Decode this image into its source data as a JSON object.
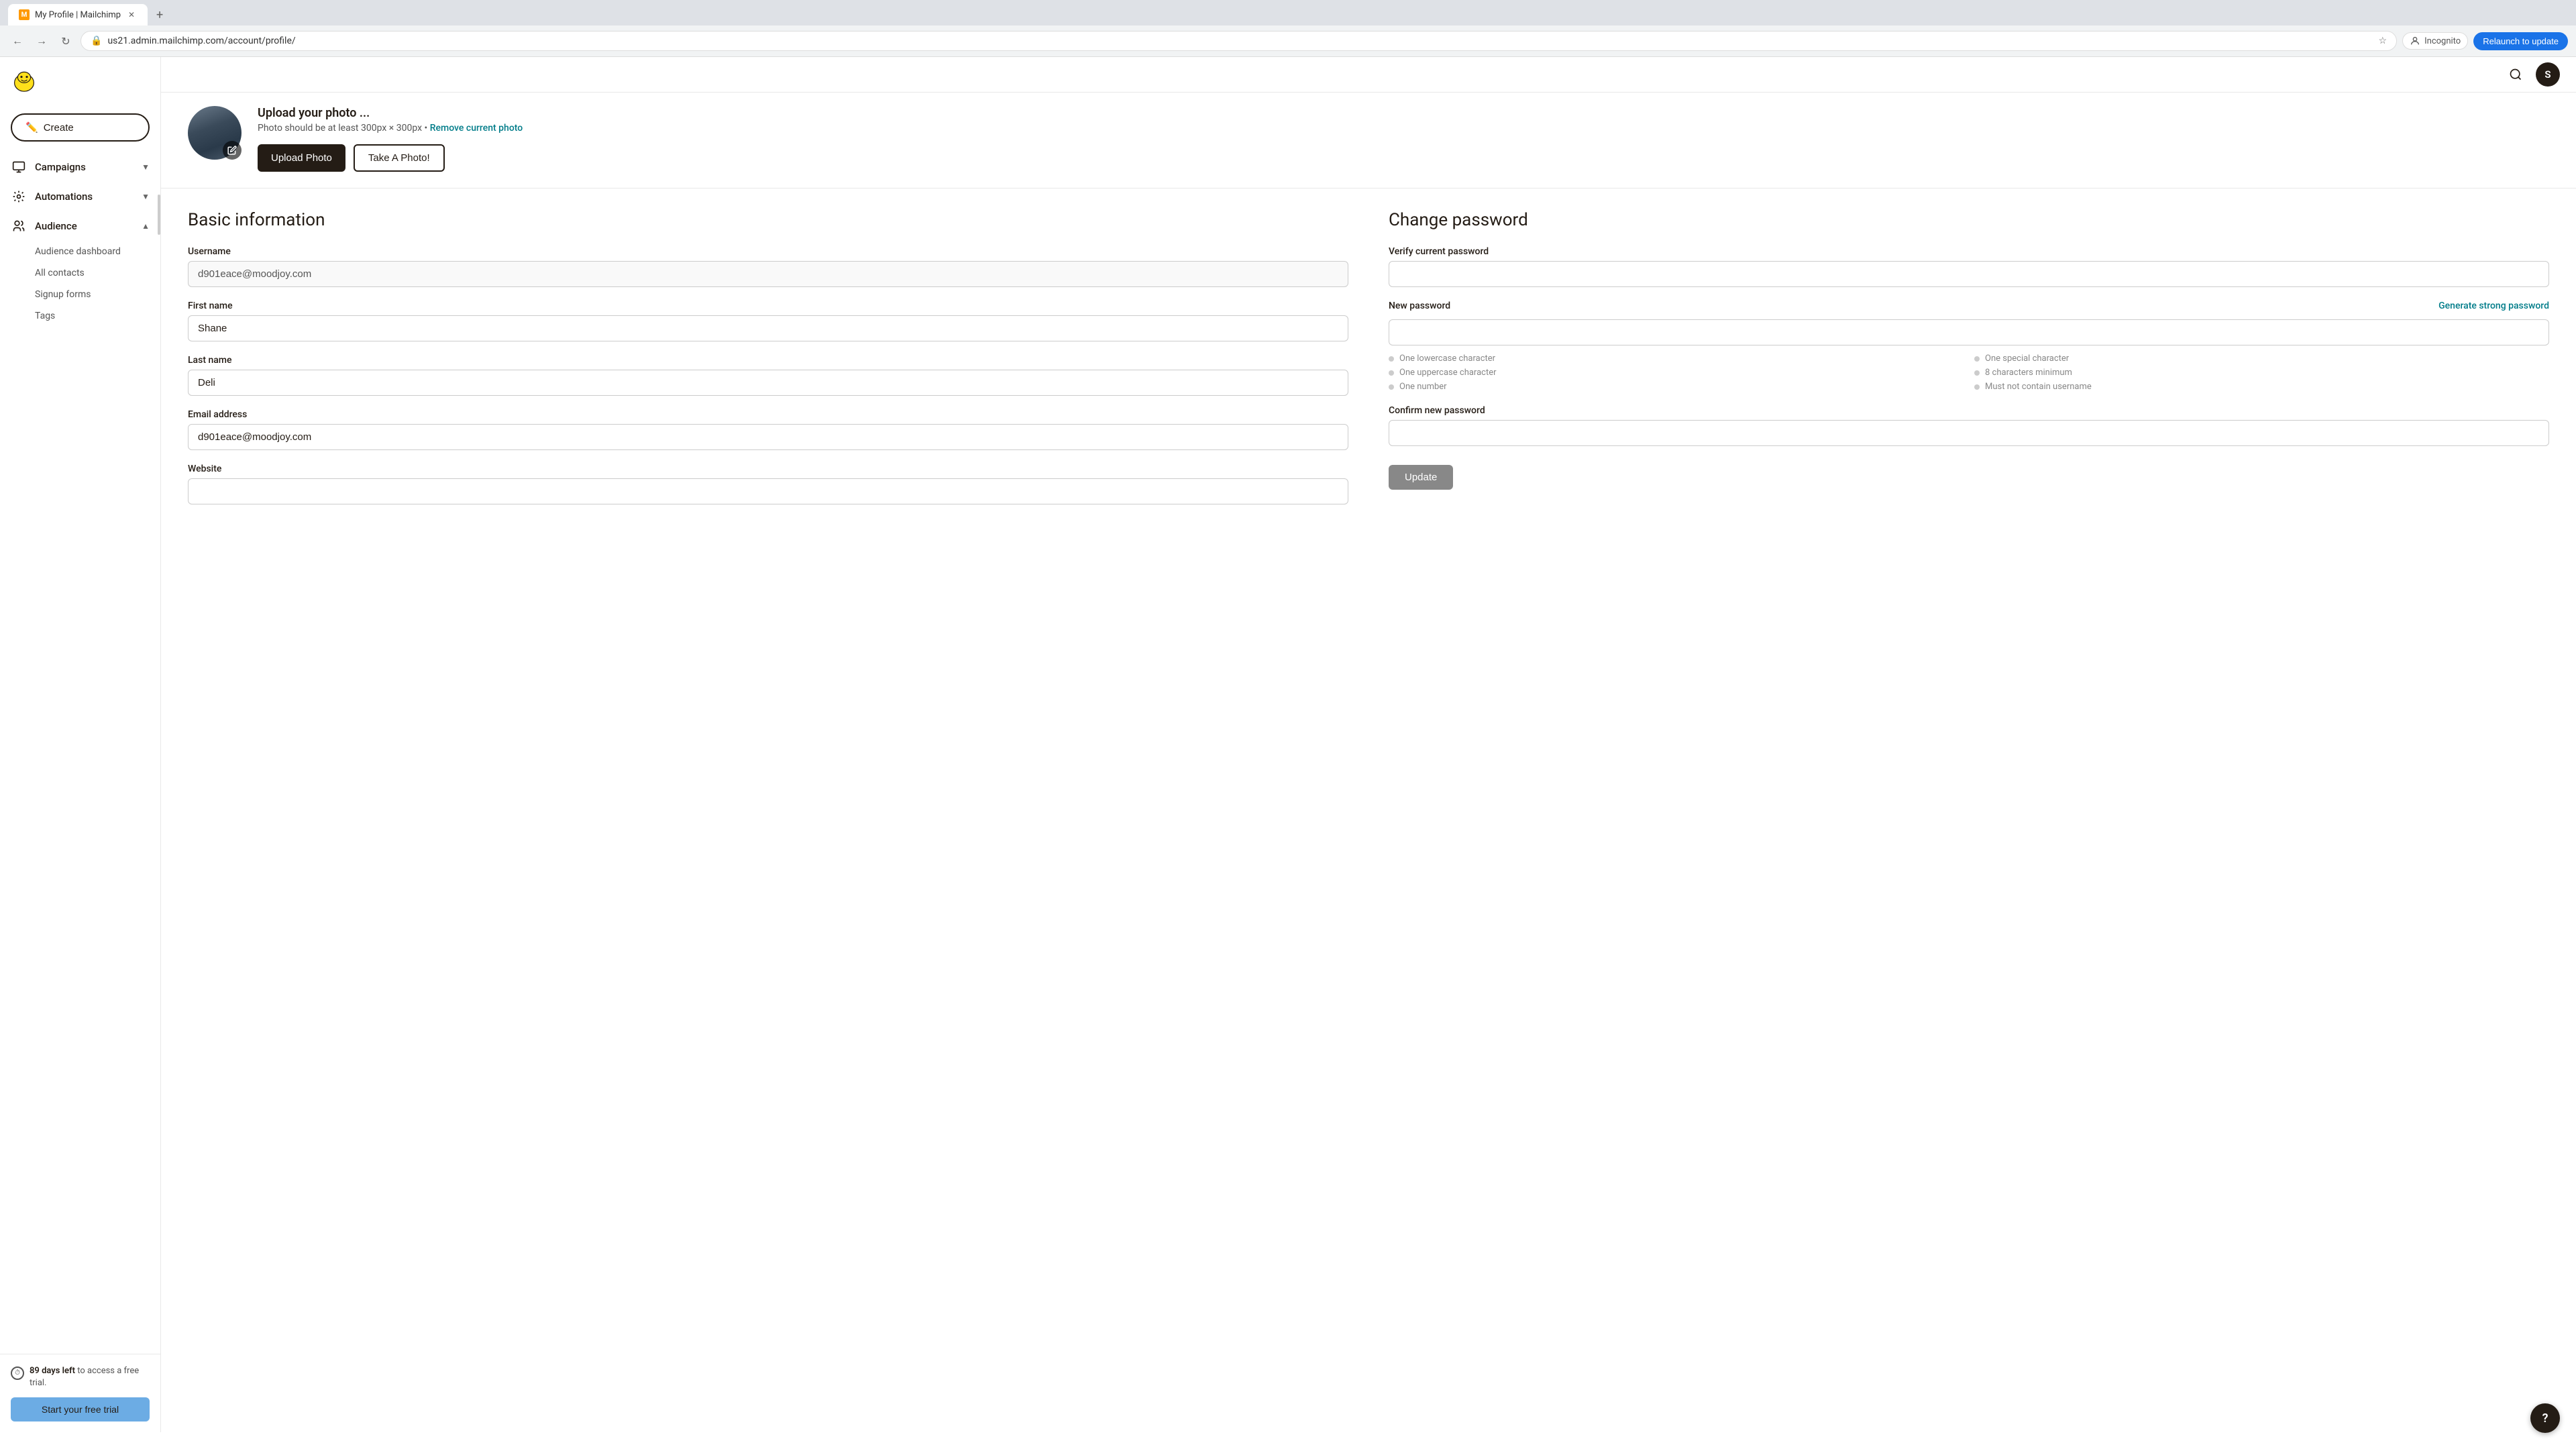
{
  "browser": {
    "tab_title": "My Profile | Mailchimp",
    "url": "us21.admin.mailchimp.com/account/profile/",
    "relaunch_label": "Relaunch to update",
    "incognito_label": "Incognito"
  },
  "header": {
    "avatar_initials": "S",
    "search_aria": "Search"
  },
  "sidebar": {
    "create_label": "Create",
    "nav_items": [
      {
        "label": "Campaigns",
        "has_arrow": true,
        "expanded": false
      },
      {
        "label": "Automations",
        "has_arrow": true,
        "expanded": false
      },
      {
        "label": "Audience",
        "has_arrow": true,
        "expanded": true
      }
    ],
    "audience_sub_items": [
      {
        "label": "Audience dashboard"
      },
      {
        "label": "All contacts"
      },
      {
        "label": "Signup forms"
      },
      {
        "label": "Tags"
      }
    ],
    "trial_days": "89 days left",
    "trial_description": " to access a free trial.",
    "trial_button": "Start your free trial"
  },
  "photo_section": {
    "title": "Upload your photo ...",
    "description": "Photo should be at least 300px × 300px • ",
    "remove_link": "Remove current photo",
    "upload_button": "Upload Photo",
    "take_photo_button": "Take A Photo!"
  },
  "basic_info": {
    "section_title": "Basic information",
    "username_label": "Username",
    "username_value": "d901eace@moodjoy.com",
    "first_name_label": "First name",
    "first_name_value": "Shane",
    "last_name_label": "Last name",
    "last_name_value": "Deli",
    "email_label": "Email address",
    "email_value": "d901eace@moodjoy.com",
    "website_label": "Website"
  },
  "change_password": {
    "section_title": "Change password",
    "verify_label": "Verify current password",
    "new_password_label": "New password",
    "generate_link": "Generate strong password",
    "requirements": [
      {
        "text": "One lowercase character"
      },
      {
        "text": "One special character"
      },
      {
        "text": "One uppercase character"
      },
      {
        "text": "8 characters minimum"
      },
      {
        "text": "One number"
      },
      {
        "text": "Must not contain username"
      }
    ],
    "confirm_label": "Confirm new password",
    "update_button": "Update"
  },
  "help": {
    "label": "?"
  }
}
